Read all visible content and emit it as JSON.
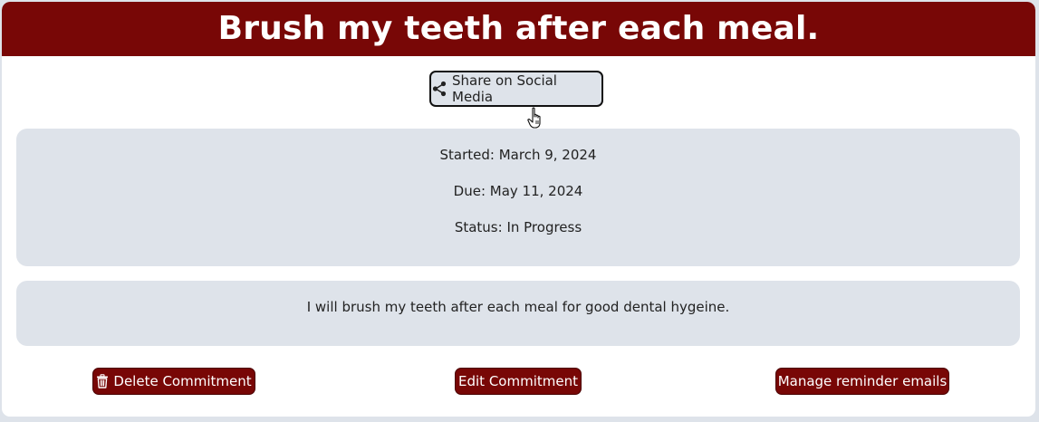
{
  "commitment": {
    "title": "Brush my teeth after each meal.",
    "share_label": "Share on Social Media",
    "started": "Started: March 9, 2024",
    "due": "Due: May 11, 2024",
    "status": "Status: In Progress",
    "description": "I will brush my teeth after each meal for good dental hygeine."
  },
  "actions": {
    "delete_label": "Delete Commitment",
    "edit_label": "Edit Commitment",
    "reminder_label": "Manage reminder emails"
  },
  "icons": {
    "share": "share-icon",
    "delete": "trash-icon",
    "cursor": "hand-pointer-icon"
  },
  "colors": {
    "brand": "#780706",
    "panel": "#dee3ea",
    "background": "#ffffff"
  }
}
